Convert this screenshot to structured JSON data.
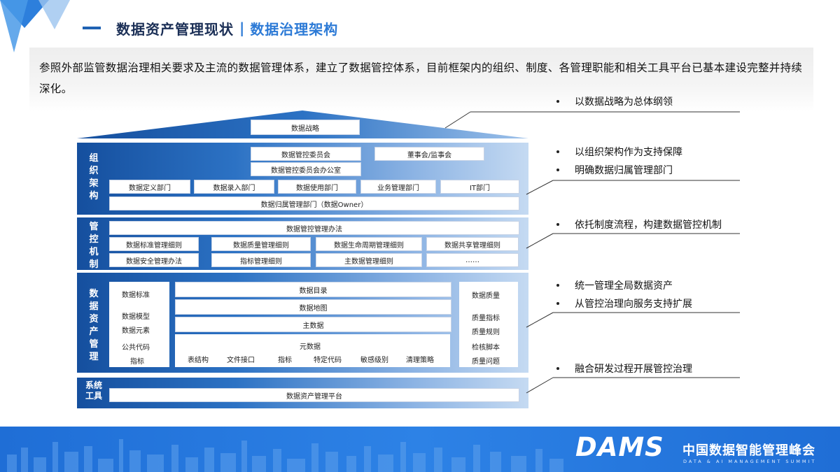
{
  "header": {
    "title": "数据资产管理现状",
    "separator": "|",
    "subtitle": "数据治理架构"
  },
  "intro": {
    "text": "参照外部监管数据治理相关要求及主流的数据管理体系，建立了数据管控体系，目前框架内的组织、制度、各管理职能和相关工具平台已基本建设完整并持续深化。"
  },
  "diagram": {
    "strategy": "数据战略",
    "org": {
      "label": "组织架构",
      "committee": "数据管控委员会",
      "board": "董事会/监事会",
      "office": "数据管控委员会办公室",
      "departments": [
        "数据定义部门",
        "数据录入部门",
        "数据使用部门",
        "业务管理部门",
        "IT部门"
      ],
      "owner": "数据归属管理部门（数据Owner）"
    },
    "control": {
      "label": "管控机制",
      "header": "数据管控管理办法",
      "row1": [
        "数据标准管理细则",
        "数据质量管理细则",
        "数据生命周期管理细则",
        "数据共享管理细则"
      ],
      "row2": [
        "数据安全管理办法",
        "指标管理细则",
        "主数据管理细则",
        "……"
      ]
    },
    "asset": {
      "label": "数据资产管理",
      "left": [
        "数据标准",
        "数据模型",
        "数据元素",
        "公共代码",
        "指标"
      ],
      "center": [
        "数据目录",
        "数据地图",
        "主数据"
      ],
      "meta": {
        "title": "元数据",
        "items": [
          "表结构",
          "文件接口",
          "指标",
          "特定代码",
          "敏感级别",
          "清理策略"
        ]
      },
      "right": [
        "数据质量",
        "质量指标",
        "质量规则",
        "检核脚本",
        "质量问题"
      ]
    },
    "tools": {
      "label": "系统工具",
      "platform": "数据资产管理平台"
    }
  },
  "right_notes": [
    [
      "以数据战略为总体纲领"
    ],
    [
      "以组织架构作为支持保障",
      "明确数据归属管理部门"
    ],
    [
      "依托制度流程，构建数据管控机制"
    ],
    [
      "统一管理全局数据资产",
      "从管控治理向服务支持扩展"
    ],
    [
      "融合研发过程开展管控治理"
    ]
  ],
  "footer": {
    "logo": "DAMS",
    "name_cn": "中国数据智能管理峰会",
    "name_en": "DATA & AI MANAGEMENT SUMMIT"
  },
  "colors": {
    "primary": "#1f62b3",
    "accent": "#2c7ad6",
    "banner": "#2d82e6"
  }
}
